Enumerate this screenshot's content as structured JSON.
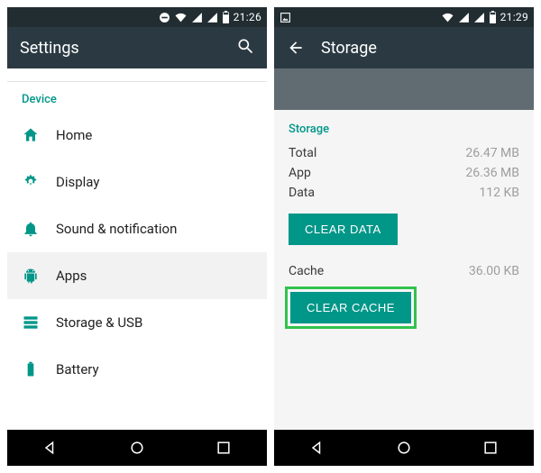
{
  "left": {
    "status_time": "21:26",
    "appbar_title": "Settings",
    "section_label": "Device",
    "items": [
      {
        "label": "Home"
      },
      {
        "label": "Display"
      },
      {
        "label": "Sound & notification"
      },
      {
        "label": "Apps"
      },
      {
        "label": "Storage & USB"
      },
      {
        "label": "Battery"
      }
    ]
  },
  "right": {
    "status_time": "21:29",
    "appbar_title": "Storage",
    "section_label": "Storage",
    "rows": {
      "total_label": "Total",
      "total_value": "26.47 MB",
      "app_label": "App",
      "app_value": "26.36 MB",
      "data_label": "Data",
      "data_value": "112 KB",
      "cache_label": "Cache",
      "cache_value": "36.00 KB"
    },
    "buttons": {
      "clear_data": "CLEAR DATA",
      "clear_cache": "CLEAR CACHE"
    }
  }
}
